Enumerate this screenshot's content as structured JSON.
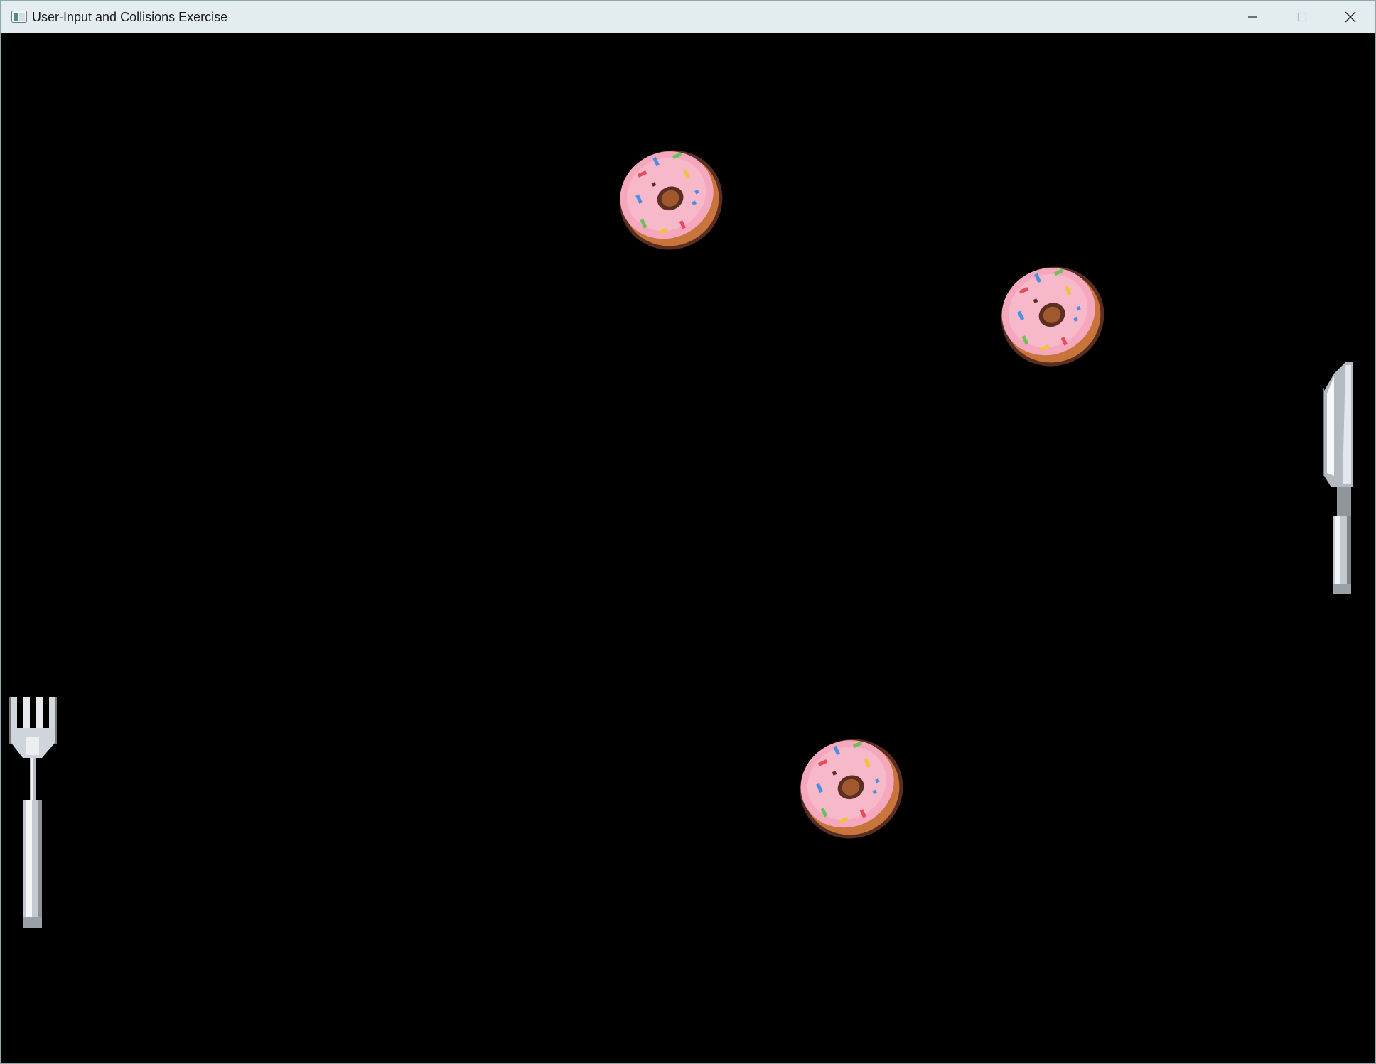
{
  "window": {
    "title": "User-Input and Collisions Exercise",
    "app_icon": "window-app-icon",
    "controls": {
      "minimize_icon": "minimize-icon",
      "maximize_icon": "maximize-icon",
      "close_icon": "close-icon"
    }
  },
  "game": {
    "background_color": "#000000",
    "sprites": [
      {
        "type": "donut",
        "icon": "donut-icon"
      },
      {
        "type": "donut",
        "icon": "donut-icon"
      },
      {
        "type": "donut",
        "icon": "donut-icon"
      },
      {
        "type": "fork",
        "icon": "fork-icon"
      },
      {
        "type": "knife",
        "icon": "knife-icon"
      }
    ]
  },
  "colors": {
    "frosting": "#f4a7bd",
    "dough": "#c8743a",
    "outline": "#5a2e22",
    "metal": "#c9ced3"
  }
}
